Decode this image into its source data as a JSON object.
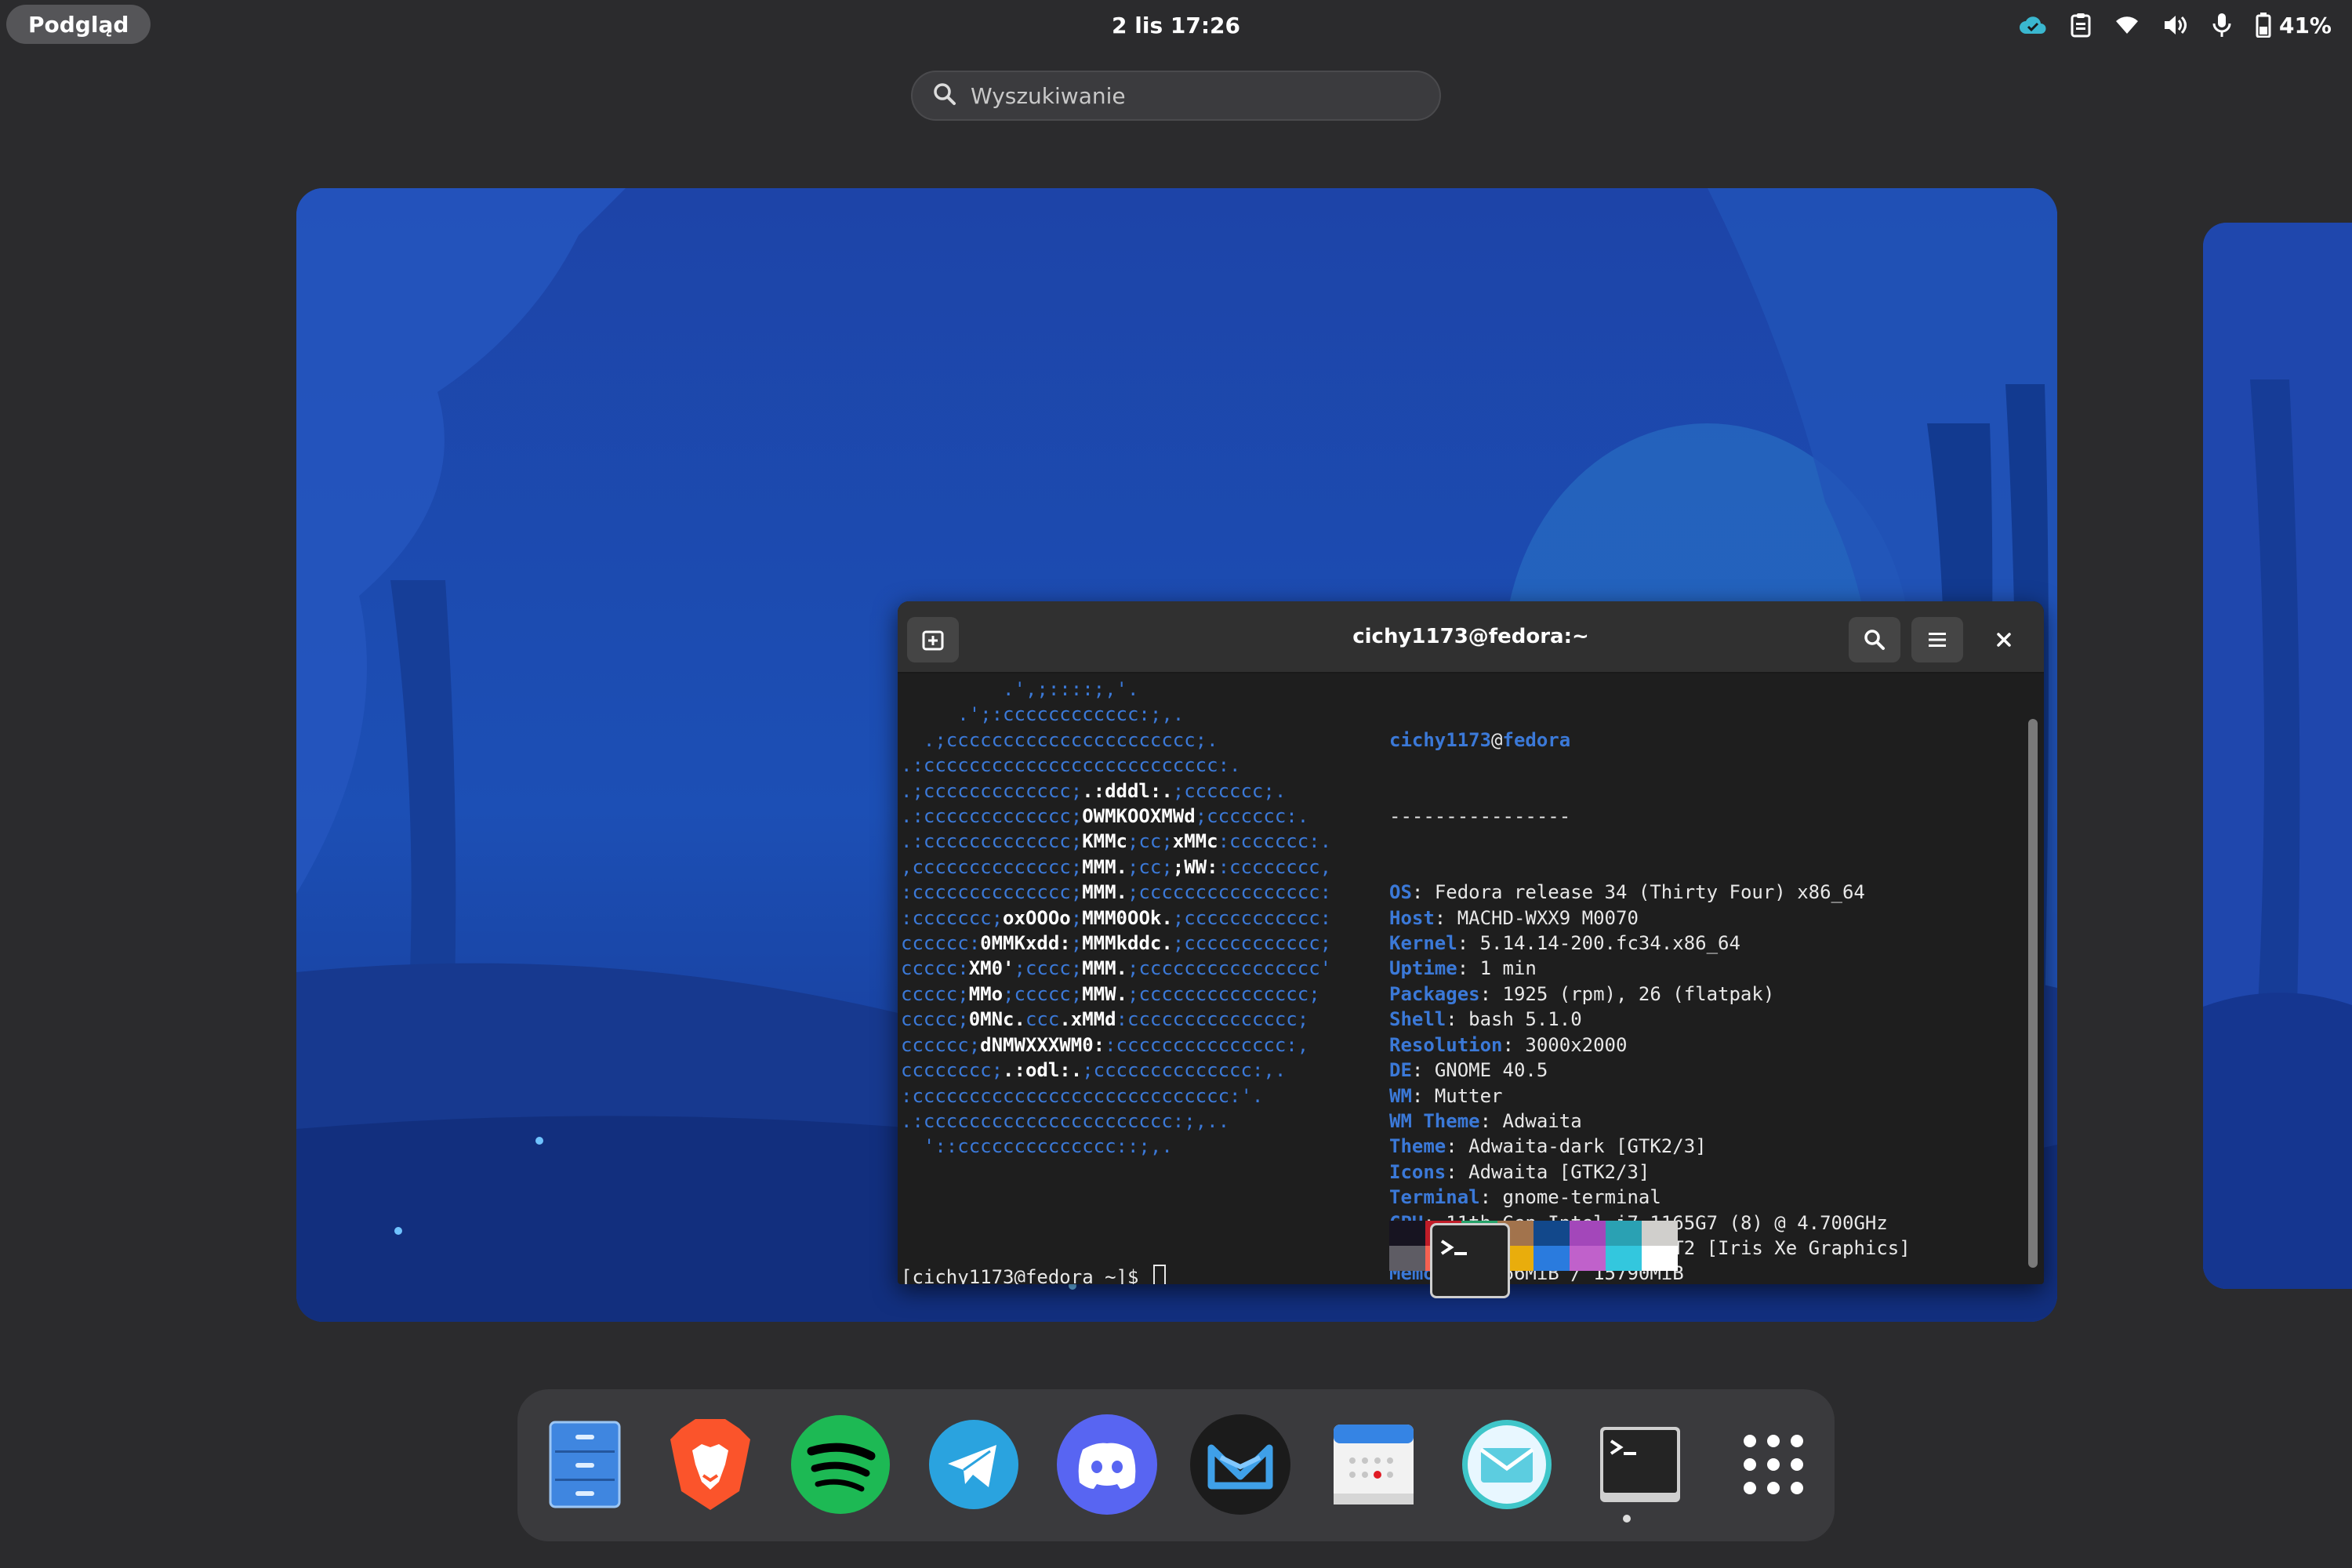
{
  "topbar": {
    "activities_label": "Podgląd",
    "clock": "2 lis  17:26",
    "battery_pct": "41%",
    "tray_icons": [
      "cloud-check-icon",
      "clipboard-icon",
      "wifi-icon",
      "volume-icon",
      "microphone-icon",
      "battery-icon"
    ]
  },
  "search": {
    "placeholder": "Wyszukiwanie"
  },
  "terminal": {
    "title": "cichy1173@fedora:~",
    "logo_lines": [
      [
        [
          "         .',;::::;,'.",
          0
        ]
      ],
      [
        [
          "     .';:cccccccccccc:;,.",
          0
        ]
      ],
      [
        [
          "  .;cccccccccccccccccccccc;.",
          0
        ]
      ],
      [
        [
          ".:cccccccccccccccccccccccccc:.",
          0
        ]
      ],
      [
        [
          ".;ccccccccccccc;",
          0
        ],
        [
          ".:dddl:.",
          1
        ],
        [
          ";ccccccc;.",
          0
        ]
      ],
      [
        [
          ".:ccccccccccccc;",
          0
        ],
        [
          "OWMKOOXMWd",
          1
        ],
        [
          ";ccccccc:.",
          0
        ]
      ],
      [
        [
          ".:ccccccccccccc;",
          0
        ],
        [
          "KMMc",
          1
        ],
        [
          ";cc;",
          0
        ],
        [
          "xMMc",
          1
        ],
        [
          ":ccccccc:.",
          0
        ]
      ],
      [
        [
          ",cccccccccccccc;",
          0
        ],
        [
          "MMM.",
          1
        ],
        [
          ";cc;",
          0
        ],
        [
          ";WW:",
          1
        ],
        [
          ":cccccccc,",
          0
        ]
      ],
      [
        [
          ":cccccccccccccc;",
          0
        ],
        [
          "MMM.",
          1
        ],
        [
          ";cccccccccccccccc:",
          0
        ]
      ],
      [
        [
          ":ccccccc;",
          0
        ],
        [
          "oxOOOo",
          1
        ],
        [
          ";",
          0
        ],
        [
          "MMM0OOk.",
          1
        ],
        [
          ";cccccccccccc:",
          0
        ]
      ],
      [
        [
          "cccccc:",
          0
        ],
        [
          "0MMKxdd:",
          1
        ],
        [
          ";",
          0
        ],
        [
          "MMMkddc.",
          1
        ],
        [
          ";cccccccccccc;",
          0
        ]
      ],
      [
        [
          "ccccc:",
          0
        ],
        [
          "XM0'",
          1
        ],
        [
          ";cccc;",
          0
        ],
        [
          "MMM.",
          1
        ],
        [
          ";cccccccccccccccc'",
          0
        ]
      ],
      [
        [
          "ccccc;",
          0
        ],
        [
          "MMo",
          1
        ],
        [
          ";ccccc;",
          0
        ],
        [
          "MMW.",
          1
        ],
        [
          ";ccccccccccccccc;",
          0
        ]
      ],
      [
        [
          "ccccc;",
          0
        ],
        [
          "0MNc.",
          1
        ],
        [
          "ccc",
          0
        ],
        [
          ".xMMd",
          1
        ],
        [
          ":ccccccccccccccc;",
          0
        ]
      ],
      [
        [
          "cccccc;",
          0
        ],
        [
          "dNMWXXXWM0:",
          1
        ],
        [
          ":ccccccccccccccc:,",
          0
        ]
      ],
      [
        [
          "cccccccc;",
          0
        ],
        [
          ".:odl:.",
          1
        ],
        [
          ";cccccccccccccc:,.",
          0
        ]
      ],
      [
        [
          ":cccccccccccccccccccccccccccc:'.",
          0
        ]
      ],
      [
        [
          ".:cccccccccccccccccccccc:;,..",
          0
        ]
      ],
      [
        [
          "  '::cccccccccccccc::;,.",
          0
        ]
      ]
    ],
    "user": "cichy1173",
    "at": "@",
    "host": "fedora",
    "separator": "----------------",
    "info": [
      {
        "key": "OS",
        "value": "Fedora release 34 (Thirty Four) x86_64"
      },
      {
        "key": "Host",
        "value": "MACHD-WXX9 M0070"
      },
      {
        "key": "Kernel",
        "value": "5.14.14-200.fc34.x86_64"
      },
      {
        "key": "Uptime",
        "value": "1 min"
      },
      {
        "key": "Packages",
        "value": "1925 (rpm), 26 (flatpak)"
      },
      {
        "key": "Shell",
        "value": "bash 5.1.0"
      },
      {
        "key": "Resolution",
        "value": "3000x2000"
      },
      {
        "key": "DE",
        "value": "GNOME 40.5"
      },
      {
        "key": "WM",
        "value": "Mutter"
      },
      {
        "key": "WM Theme",
        "value": "Adwaita"
      },
      {
        "key": "Theme",
        "value": "Adwaita-dark [GTK2/3]"
      },
      {
        "key": "Icons",
        "value": "Adwaita [GTK2/3]"
      },
      {
        "key": "Terminal",
        "value": "gnome-terminal"
      },
      {
        "key": "CPU",
        "value": "11th Gen Intel i7-1165G7 (8) @ 4.700GHz"
      },
      {
        "key": "GPU",
        "value": "Intel TigerLake-LP GT2 [Iris Xe Graphics]"
      },
      {
        "key": "Memory",
        "value": "1866MiB / 15790MiB"
      }
    ],
    "palette": [
      "#171421",
      "#c01c28",
      "#26a269",
      "#a2734c",
      "#12488b",
      "#a347ba",
      "#2aa1b3",
      "#d0cfcc",
      "#5e5c64",
      "#f66151",
      "#33d17a",
      "#e9ad0c",
      "#2a7bde",
      "#c061cb",
      "#33c7de",
      "#ffffff"
    ],
    "prompt": "[cichy1173@fedora ~]$"
  },
  "dock": {
    "apps": [
      "files-icon",
      "brave-icon",
      "spotify-icon",
      "telegram-icon",
      "discord-icon",
      "mailspring-icon",
      "calendar-icon",
      "mail-icon",
      "terminal-icon",
      "app-grid-icon"
    ]
  }
}
